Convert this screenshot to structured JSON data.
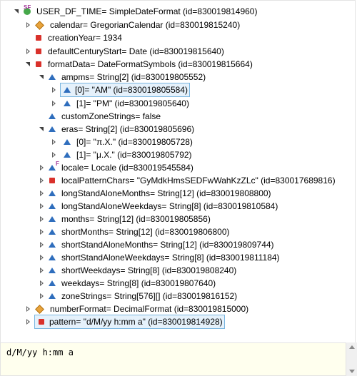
{
  "tree": {
    "root": {
      "label": "USER_DF_TIME= SimpleDateFormat  (id=830019814960)",
      "badge": "SF"
    },
    "items": [
      {
        "label": "calendar= GregorianCalendar  (id=830019815240)"
      },
      {
        "label": "creationYear= 1934"
      },
      {
        "label": "defaultCenturyStart= Date  (id=830019815640)"
      },
      {
        "label": "formatData= DateFormatSymbols  (id=830019815664)"
      },
      {
        "label": "ampms= String[2]  (id=830019805552)"
      },
      {
        "label": "[0]= \"AM\"  (id=830019805584)"
      },
      {
        "label": "[1]= \"PM\"  (id=830019805640)"
      },
      {
        "label": "customZoneStrings= false"
      },
      {
        "label": "eras= String[2]  (id=830019805696)"
      },
      {
        "label": "[0]= \"π.Χ.\"  (id=830019805728)"
      },
      {
        "label": "[1]= \"μ.Χ.\"  (id=830019805792)"
      },
      {
        "label": "locale= Locale  (id=830019545584)",
        "badge": "F"
      },
      {
        "label": "localPatternChars= \"GyMdkHmsSEDFwWahKzZLc\"  (id=830017689816)"
      },
      {
        "label": "longStandAloneMonths= String[12]  (id=830019808800)"
      },
      {
        "label": "longStandAloneWeekdays= String[8]  (id=830019810584)"
      },
      {
        "label": "months= String[12]  (id=830019805856)"
      },
      {
        "label": "shortMonths= String[12]  (id=830019806800)"
      },
      {
        "label": "shortStandAloneMonths= String[12]  (id=830019809744)"
      },
      {
        "label": "shortStandAloneWeekdays= String[8]  (id=830019811184)"
      },
      {
        "label": "shortWeekdays= String[8]  (id=830019808240)"
      },
      {
        "label": "weekdays= String[8]  (id=830019807640)"
      },
      {
        "label": "zoneStrings= String[576][]  (id=830019816152)"
      },
      {
        "label": "numberFormat= DecimalFormat  (id=830019815000)"
      },
      {
        "label": "pattern= \"d/M/yy h:mm a\"  (id=830019814928)"
      }
    ]
  },
  "detail": {
    "value": "d/M/yy h:mm a"
  },
  "colors": {
    "selection_bg": "#e5f1fb",
    "selection_border": "#7ab6e0",
    "detail_bg": "#ffffee"
  }
}
